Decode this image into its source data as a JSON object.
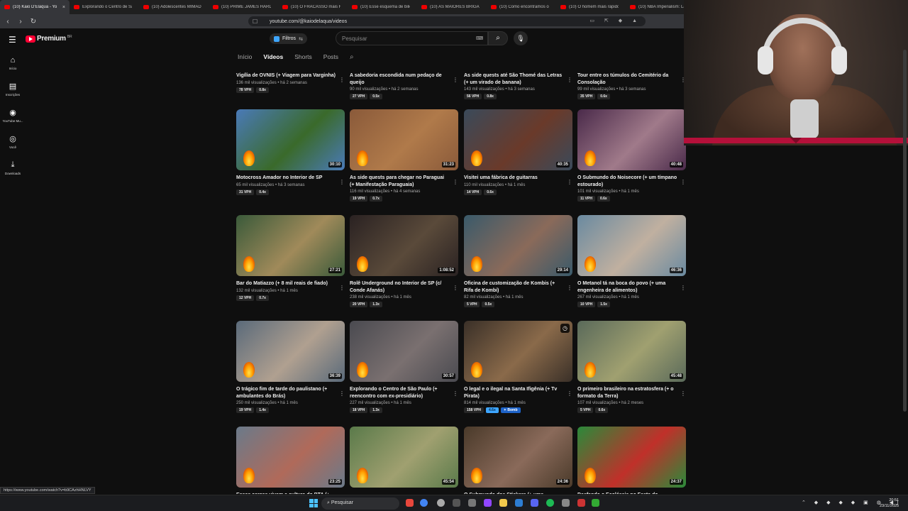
{
  "browser": {
    "tabs": [
      {
        "label": "(10) Kaio D'Elaqua - Yo",
        "active": true
      },
      {
        "label": "Explorando o Centro de Sã"
      },
      {
        "label": "(10) Adolescentes MIMADO"
      },
      {
        "label": "(10) PRIME JAMES HARDEN"
      },
      {
        "label": "(10) O FRACASSO mais HYP"
      },
      {
        "label": "(10) Esse esquema de bilio"
      },
      {
        "label": "(10) AS MAIORES BRIGAS D"
      },
      {
        "label": "(10) Como encontramos o"
      },
      {
        "label": "(10) O homem mais rápido"
      },
      {
        "label": "(10) NBA Imperialism: La"
      }
    ],
    "url": "youtube.com/@kaiodelaqua/videos",
    "hover_url": "https://www.youtube.com/watch?v=b9CAzhHNLVY"
  },
  "masthead": {
    "logo_label": "Premium",
    "logo_country": "BR",
    "filters_label": "Filtros",
    "search_placeholder": "Pesquisar"
  },
  "sidebar": [
    {
      "label": "Início",
      "icon": "home-icon"
    },
    {
      "label": "Inscrições",
      "icon": "subscriptions-icon"
    },
    {
      "label": "YouTube Mu...",
      "icon": "youtube-music-icon"
    },
    {
      "label": "Você",
      "icon": "you-icon"
    },
    {
      "label": "Downloads",
      "icon": "download-icon"
    }
  ],
  "channel_tabs": [
    {
      "label": "Início",
      "selected": false
    },
    {
      "label": "Vídeos",
      "selected": true
    },
    {
      "label": "Shorts",
      "selected": false
    },
    {
      "label": "Posts",
      "selected": false
    }
  ],
  "videos": [
    {
      "title": "Vigília de OVNIS (+ Viagem para Varginha)",
      "views": "136 mil visualizações",
      "age": "há 2 semanas",
      "vph": "78 VPH",
      "ratio": "0.8x"
    },
    {
      "title": "A sabedoria escondida num pedaço de queijo",
      "views": "90 mil visualizações",
      "age": "há 2 semanas",
      "vph": "27 VPH",
      "ratio": "0.5x"
    },
    {
      "title": "As side quests até São Thomé das Letras (+ um virado de banana)",
      "views": "143 mil visualizações",
      "age": "há 3 semanas",
      "vph": "56 VPH",
      "ratio": "0.8x"
    },
    {
      "title": "Tour entre os túmulos do Cemitério da Consolação",
      "views": "99 mil visualizações",
      "age": "há 3 semanas",
      "vph": "35 VPH",
      "ratio": "0.6x"
    },
    {
      "title": "Motocross Amador no Interior de SP",
      "views": "65 mil visualizações",
      "age": "há 3 semanas",
      "vph": "31 VPH",
      "ratio": "0.4x",
      "duration": "30:10"
    },
    {
      "title": "As side quests para chegar no Paraguai (+ Manifestação Paraguaia)",
      "views": "116 mil visualizações",
      "age": "há 4 semanas",
      "vph": "19 VPH",
      "ratio": "0.7x",
      "duration": "31:23"
    },
    {
      "title": "Visitei uma fábrica de guitarras",
      "views": "110 mil visualizações",
      "age": "há 1 mês",
      "vph": "14 VPH",
      "ratio": "0.6x",
      "duration": "40:35"
    },
    {
      "title": "O Submundo do Noisecore (+ um tímpano estourado)",
      "views": "101 mil visualizações",
      "age": "há 1 mês",
      "vph": "11 VPH",
      "ratio": "0.6x",
      "duration": "40:48"
    },
    {
      "title": "Bar do Matiazzo (+ 8 mil reais de fiado)",
      "views": "132 mil visualizações",
      "age": "há 1 mês",
      "vph": "12 VPH",
      "ratio": "0.7x",
      "duration": "27:21"
    },
    {
      "title": "Rolê Underground no Interior de SP (c/ Conde Afanás)",
      "views": "238 mil visualizações",
      "age": "há 1 mês",
      "vph": "20 VPH",
      "ratio": "1.3x",
      "duration": "1:08:52"
    },
    {
      "title": "Oficina de customização de Kombis (+ Rifa de Kombi)",
      "views": "82 mil visualizações",
      "age": "há 1 mês",
      "vph": "5 VPH",
      "ratio": "0.5x",
      "duration": "29:14"
    },
    {
      "title": "O Metanol tá na boca do povo (+ uma engenheira de alimentos)",
      "views": "267 mil visualizações",
      "age": "há 1 mês",
      "vph": "10 VPH",
      "ratio": "1.5x",
      "duration": "46:36"
    },
    {
      "title": "O trágico fim de tarde do paulistano (+ ambulantes do Brás)",
      "views": "250 mil visualizações",
      "age": "há 1 mês",
      "vph": "19 VPH",
      "ratio": "1.4x",
      "duration": "36:39"
    },
    {
      "title": "Explorando o Centro de São Paulo (+ reencontro com ex-presidiário)",
      "views": "227 mil visualizações",
      "age": "há 1 mês",
      "vph": "18 VPH",
      "ratio": "1.3x",
      "duration": "30:57"
    },
    {
      "title": "O legal e o ilegal na Santa Ifigênia (+ Tv Pirata)",
      "views": "814 mil visualizações",
      "age": "há 1 mês",
      "vph": "158 VPH",
      "ratio": "4.6x",
      "extra_badge": "Bomb",
      "clock": true
    },
    {
      "title": "O primeiro brasileiro na estratosfera (+ o formato da Terra)",
      "views": "107 mil visualizações",
      "age": "há 2 meses",
      "vph": "5 VPH",
      "ratio": "0.6x",
      "duration": "45:48"
    },
    {
      "title": "Essas carcas vivem a cultura do BTA (+",
      "views": "",
      "age": "",
      "vph": "",
      "ratio": "",
      "duration": "23:25"
    },
    {
      "title": "",
      "views": "",
      "age": "",
      "vph": "",
      "ratio": "",
      "duration": "45:54"
    },
    {
      "title": "O Submundo dos Stickers (+ uma",
      "views": "",
      "age": "",
      "vph": "",
      "ratio": "",
      "duration": "24:36"
    },
    {
      "title": "Desfando o Ecoléssia no Festa do Aoblessitte",
      "views": "",
      "age": "",
      "vph": "",
      "ratio": "",
      "duration": "24:37"
    }
  ],
  "taskbar": {
    "search_label": "Pesquisar",
    "time": "20:51",
    "date": "23/11/2025"
  },
  "colors": {
    "accent": "#3ea6ff",
    "brand_red": "#ff0033",
    "background": "#0f0f0f"
  }
}
